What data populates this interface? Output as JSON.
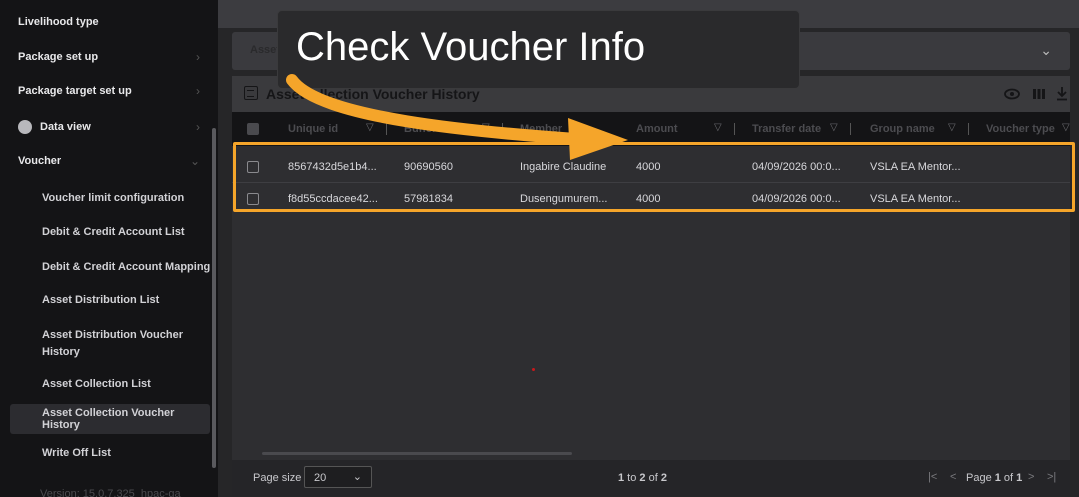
{
  "sidebar": {
    "items": [
      {
        "label": "Livelihood type"
      },
      {
        "label": "Package set up"
      },
      {
        "label": "Package target set up"
      },
      {
        "label": "Data view"
      },
      {
        "label": "Voucher"
      },
      {
        "label": "Voucher limit configuration"
      },
      {
        "label": "Debit & Credit Account List"
      },
      {
        "label": "Debit & Credit Account Mapping"
      },
      {
        "label": "Asset Distribution List"
      },
      {
        "label": "Asset Distribution Voucher",
        "label2": "History"
      },
      {
        "label": "Asset Collection List"
      },
      {
        "label": "Asset Collection Voucher History"
      },
      {
        "label": "Write Off List"
      }
    ],
    "version": "Version: 15.0.7.325_hpac-ga"
  },
  "filter": {
    "label": "Asset Collection"
  },
  "panel": {
    "title": "Asset Collection Voucher History",
    "title_visible": "Asset    llection Voucher History"
  },
  "table": {
    "columns": [
      "Unique id",
      "Buffer id",
      "Member name",
      "Amount",
      "Transfer date",
      "Group name",
      "Voucher type"
    ],
    "columns_visible": [
      "Unique id",
      "Buffer id",
      "Member",
      "Amount",
      "Transfer date",
      "Group name",
      "Voucher type"
    ],
    "rows": [
      {
        "unique_id": "8567432d5e1b4...",
        "buffer_id": "90690560",
        "member": "Ingabire Claudine",
        "amount": "4000",
        "transfer_date": "04/09/2026 00:0...",
        "group": "VSLA EA Mentor..."
      },
      {
        "unique_id": "f8d55ccdacee42...",
        "buffer_id": "57981834",
        "member": "Dusengumurem...",
        "amount": "4000",
        "transfer_date": "04/09/2026 00:0...",
        "group": "VSLA EA Mentor..."
      }
    ]
  },
  "pagination": {
    "size_label": "Page size",
    "size_value": "20",
    "count_from": "1",
    "count_to": "2",
    "count_total": "2",
    "count_to_word": " to ",
    "count_of_word": " of ",
    "page_word": "Page ",
    "page_current": "1",
    "page_total": "1",
    "of_word": " of "
  },
  "overlay": {
    "callout_text": "Check Voucher Info",
    "highlight_color": "#f5a52a"
  },
  "icons": {
    "eye": "eye-icon",
    "columns": "columns-icon",
    "download": "download-icon"
  },
  "colors": {
    "accent": "#f5a52a"
  }
}
